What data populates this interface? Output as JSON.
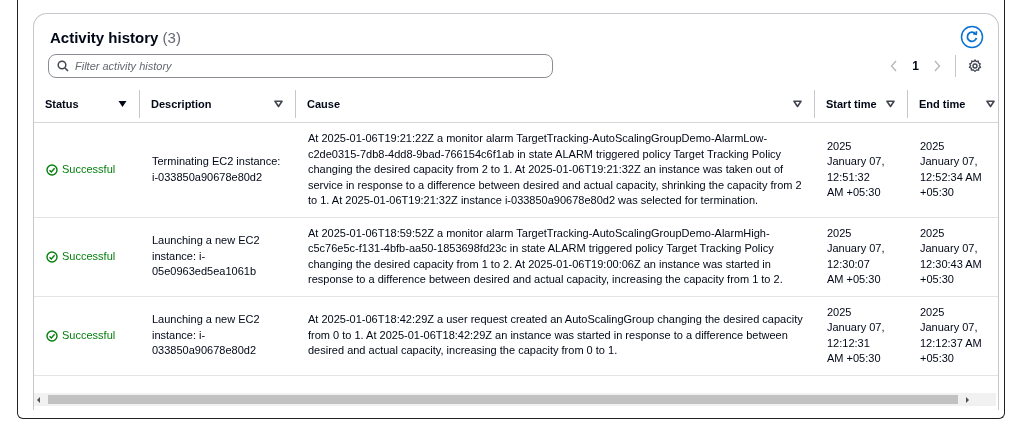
{
  "header": {
    "title": "Activity history",
    "count": "(3)"
  },
  "search": {
    "placeholder": "Filter activity history"
  },
  "pagination": {
    "prev_disabled": true,
    "next_disabled": true,
    "pages": [
      {
        "label": "1",
        "selected": true
      }
    ]
  },
  "table": {
    "columns": [
      {
        "label": "Status",
        "sorted": true
      },
      {
        "label": "Description",
        "sorted": false
      },
      {
        "label": "Cause",
        "sorted": false
      },
      {
        "label": "Start time",
        "sorted": false
      },
      {
        "label": "End time",
        "sorted": false
      }
    ],
    "rows": [
      {
        "status": "Successful",
        "kind": "success",
        "description": "Terminating EC2 instance: i-033850a90678e80d2",
        "cause": "At 2025-01-06T19:21:22Z a monitor alarm TargetTracking-AutoScalingGroupDemo-AlarmLow-c2de0315-7db8-4dd8-9bad-766154c6f1ab in state ALARM triggered policy Target Tracking Policy changing the desired capacity from 2 to 1. At 2025-01-06T19:21:32Z an instance was taken out of service in response to a difference between desired and actual capacity, shrinking the capacity from 2 to 1. At 2025-01-06T19:21:32Z instance i-033850a90678e80d2 was selected for termination.",
        "start_time": "2025\nJanuary 07,\n12:51:32\nAM +05:30",
        "end_time": "2025\nJanuary 07,\n12:52:34 AM\n+05:30"
      },
      {
        "status": "Successful",
        "kind": "success",
        "description": "Launching a new EC2 instance: i-05e0963ed5ea1061b",
        "cause": "At 2025-01-06T18:59:52Z a monitor alarm TargetTracking-AutoScalingGroupDemo-AlarmHigh-c5c76e5c-f131-4bfb-aa50-1853698fd23c in state ALARM triggered policy Target Tracking Policy changing the desired capacity from 1 to 2. At 2025-01-06T19:00:06Z an instance was started in response to a difference between desired and actual capacity, increasing the capacity from 1 to 2.",
        "start_time": "2025\nJanuary 07,\n12:30:07\nAM +05:30",
        "end_time": "2025\nJanuary 07,\n12:30:43 AM\n+05:30"
      },
      {
        "status": "Successful",
        "kind": "success",
        "description": "Launching a new EC2 instance: i-033850a90678e80d2",
        "cause": "At 2025-01-06T18:42:29Z a user request created an AutoScalingGroup changing the desired capacity from 0 to 1. At 2025-01-06T18:42:29Z an instance was started in response to a difference between desired and actual capacity, increasing the capacity from 0 to 1.",
        "start_time": "2025\nJanuary 07,\n12:12:31\nAM +05:30",
        "end_time": "2025\nJanuary 07,\n12:12:37 AM\n+05:30"
      }
    ]
  }
}
